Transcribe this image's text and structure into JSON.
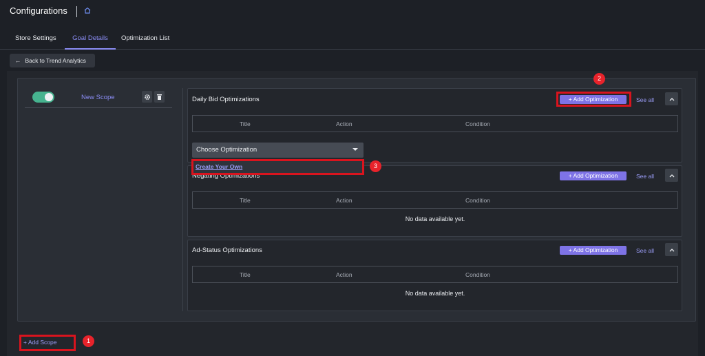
{
  "header": {
    "title": "Configurations"
  },
  "tabs": [
    {
      "label": "Store Settings",
      "active": false
    },
    {
      "label": "Goal Details",
      "active": true
    },
    {
      "label": "Optimization List",
      "active": false
    }
  ],
  "back_button": {
    "label": "Back to Trend Analytics"
  },
  "scope": {
    "name": "New Scope",
    "enabled": true
  },
  "table_columns": [
    "Title",
    "Action",
    "Condition"
  ],
  "sections": [
    {
      "title": "Daily Bid Optimizations",
      "add_label": "Add Optimization",
      "see_all": "See all"
    },
    {
      "title": "Negating Optimizations",
      "add_label": "Add Optimization",
      "see_all": "See all",
      "empty_text": "No data available yet."
    },
    {
      "title": "Ad-Status Optimizations",
      "add_label": "Add Optimization",
      "see_all": "See all",
      "empty_text": "No data available yet."
    }
  ],
  "choose_optimization": {
    "label": "Choose Optimization",
    "options": [
      "Create Your Own"
    ]
  },
  "add_scope": {
    "label": "Add Scope"
  },
  "callouts": [
    "1",
    "2",
    "3"
  ],
  "colors": {
    "accent": "#8b8df5",
    "button": "#7e73e6",
    "toggle_on": "#46b38f",
    "highlight": "#d9141e"
  }
}
